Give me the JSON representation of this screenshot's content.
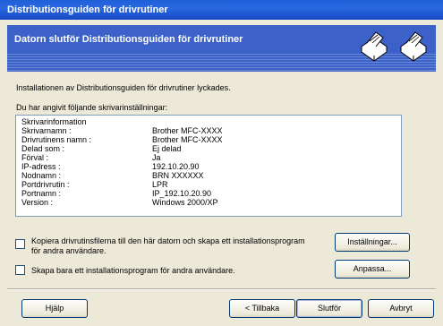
{
  "window": {
    "title": "Distributionsguiden för drivrutiner",
    "banner_title": "Datorn slutför Distributionsguiden för drivrutiner"
  },
  "intro_text": "Installationen av Distributionsguiden för drivrutiner lyckades.",
  "settings_label": "Du har angivit följande skrivarinställningar:",
  "info": {
    "header": "Skrivarinformation",
    "rows": [
      {
        "key": "Skrivarnamn :",
        "value": "Brother MFC-XXXX"
      },
      {
        "key": "Drivrutinens namn :",
        "value": "Brother MFC-XXXX"
      },
      {
        "key": "Delad som :",
        "value": "Ej delad"
      },
      {
        "key": "Förval :",
        "value": "Ja"
      },
      {
        "key": "IP-adress :",
        "value": "192.10.20.90"
      },
      {
        "key": "Nodnamn :",
        "value": "BRN XXXXXX"
      },
      {
        "key": "Portdrivrutin :",
        "value": "LPR"
      },
      {
        "key": "Portnamn :",
        "value": "IP_192.10.20.90"
      },
      {
        "key": "Version :",
        "value": "Windows 2000/XP"
      }
    ]
  },
  "options": {
    "copy_label": "Kopiera drivrutinsfilerna till den här datorn och skapa ett installationsprogram för andra användare.",
    "create_label": "Skapa bara ett installationsprogram för andra användare.",
    "settings_button": "Inställningar...",
    "customize_button": "Anpassa..."
  },
  "footer": {
    "help": "Hjälp",
    "back": "< Tillbaka",
    "finish": "Slutför",
    "cancel": "Avbryt"
  }
}
